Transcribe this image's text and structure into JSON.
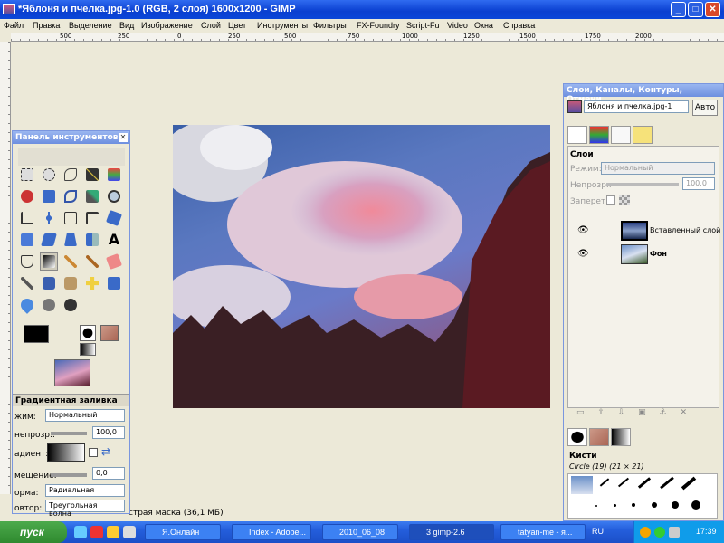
{
  "window": {
    "title": "*Яблоня и пчелка.jpg-1.0 (RGB, 2 слоя) 1600x1200 - GIMP",
    "min": "_",
    "max": "□",
    "close": "✕"
  },
  "menu": [
    "Файл",
    "Правка",
    "Выделение",
    "Вид",
    "Изображение",
    "Слой",
    "Цвет",
    "Инструменты",
    "Фильтры",
    "FX-Foundry",
    "Script-Fu",
    "Video",
    "Окна",
    "Справка"
  ],
  "ruler": {
    "h_labels": [
      "500",
      "250",
      "0",
      "250",
      "500",
      "750",
      "1000",
      "1250",
      "1500",
      "1750",
      "2000"
    ]
  },
  "status": {
    "text": "страя маска (36,1 МБ)"
  },
  "toolbox": {
    "title": "Панель инструментов",
    "close": "✕",
    "options_title": "Градиентная заливка",
    "mode_label": "жим:",
    "mode_value": "Нормальный",
    "opacity_label": "непрозр.:",
    "opacity_value": "100,0",
    "gradient_label": "адиент:",
    "offset_label": "мещение:",
    "offset_value": "0,0",
    "shape_label": "орма:",
    "shape_value": "Радиальная",
    "repeat_label": "овтор:",
    "repeat_value": "Треугольная волна"
  },
  "layers_panel": {
    "title": "Слои, Каналы, Контуры, Отмени...",
    "image_select": "Яблоня и пчелка.jpg-1",
    "auto_button": "Авто",
    "section": "Слои",
    "mode_label": "Режим:",
    "mode_value": "Нормальный",
    "opacity_label": "Непрозр.:",
    "opacity_value": "100,0",
    "lock_label": "Запереть:",
    "layers": [
      {
        "name": "Вставленный слой"
      },
      {
        "name": "Фон"
      }
    ],
    "brushes_title": "Кисти",
    "brush_info": "Circle (19) (21 × 21)"
  },
  "taskbar": {
    "start": "пуск",
    "tasks": [
      "Я.Онлайн",
      "Index - Adobe...",
      "2010_06_08",
      "3 gimp-2.6",
      "tatyan-me - я..."
    ],
    "lang": "RU",
    "clock": "17:39"
  },
  "colors": {
    "title_bar": "#0a46d8",
    "taskbar": "#245edc",
    "start": "#2f8a2f",
    "panel_border": "#7a96df"
  }
}
